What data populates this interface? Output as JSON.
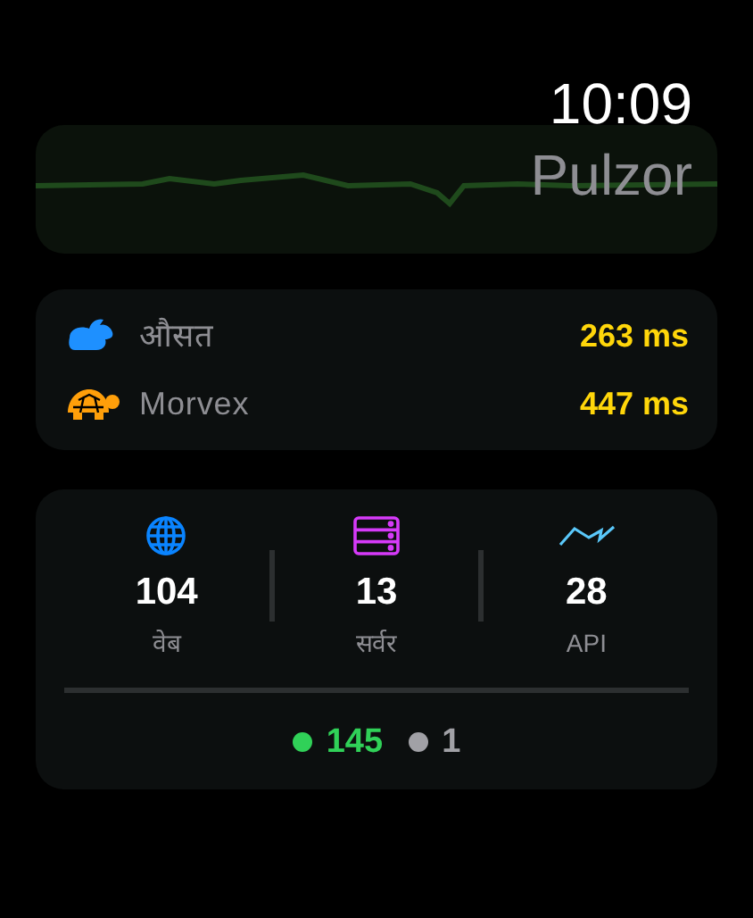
{
  "status_bar": {
    "time": "10:09",
    "app_name": "Pulzor"
  },
  "latency": [
    {
      "kind": "fast",
      "label": "औसत",
      "value": "263 ms"
    },
    {
      "kind": "slow",
      "label": "Morvex",
      "value": "447 ms"
    }
  ],
  "stats": [
    {
      "kind": "web",
      "count": "104",
      "label": "वेब"
    },
    {
      "kind": "server",
      "count": "13",
      "label": "सर्वर"
    },
    {
      "kind": "api",
      "count": "28",
      "label": "API"
    }
  ],
  "totals": [
    {
      "count": "145",
      "color": "#30d158"
    },
    {
      "count": "1",
      "color": "#a1a1a6"
    }
  ]
}
